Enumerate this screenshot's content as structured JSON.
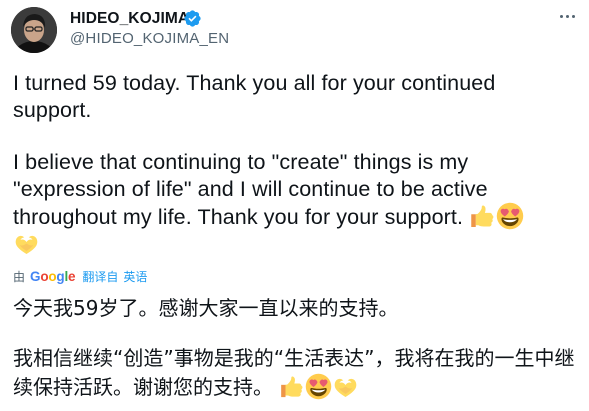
{
  "author": {
    "display_name": "HIDEO_KOJIMA",
    "handle": "@HIDEO_KOJIMA_EN",
    "verified": true
  },
  "tweet": {
    "paragraph1": "I turned 59 today. Thank you all for your continued support.",
    "paragraph2": "I believe that continuing to \"create\" things is my \"expression of life\" and I will continue to be active throughout my life. Thank you for your support."
  },
  "emojis": [
    "thumbs-up",
    "smiling-face-with-heart-eyes",
    "heart-hands"
  ],
  "translation": {
    "by_prefix": "由",
    "provider": "Google",
    "translated_from_label": "翻译自",
    "source_language": "英语",
    "paragraph1": "今天我59岁了。感谢大家一直以来的支持。",
    "paragraph2": "我相信继续“创造”事物是我的“生活表达”，我将在我的一生中继续保持活跃。谢谢您的支持。"
  },
  "colors": {
    "link_blue": "#1d9bf0",
    "verified_blue": "#1d9bf0",
    "secondary_text": "#536471"
  }
}
